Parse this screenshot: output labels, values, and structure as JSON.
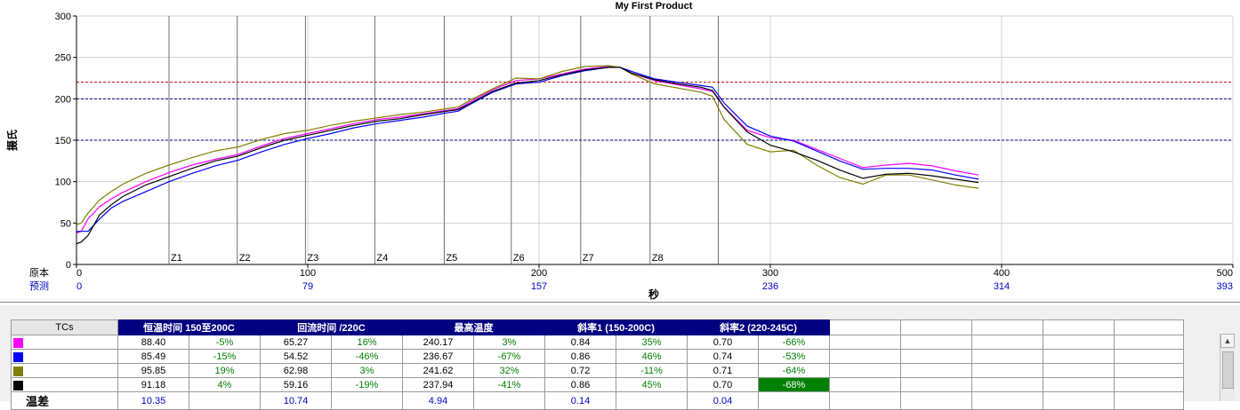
{
  "chart_data": {
    "type": "line",
    "title": "My First Product",
    "ylabel": "摄氏",
    "xlabel": "秒",
    "xlim": [
      0,
      500
    ],
    "ylim": [
      0,
      300
    ],
    "yticks": [
      0,
      50,
      100,
      150,
      200,
      250,
      300
    ],
    "xticks": [
      0,
      100,
      200,
      300,
      400,
      500
    ],
    "xrow_label_1": "原本",
    "xrow_label_2": "预测",
    "xticks_predicted": [
      "0",
      "79",
      "157",
      "236",
      "314",
      "393"
    ],
    "grid": true,
    "zones": [
      {
        "label": "Z1",
        "x": 40
      },
      {
        "label": "Z2",
        "x": 69.5
      },
      {
        "label": "Z3",
        "x": 99
      },
      {
        "label": "Z4",
        "x": 129
      },
      {
        "label": "Z5",
        "x": 159
      },
      {
        "label": "Z6",
        "x": 188
      },
      {
        "label": "Z7",
        "x": 218
      },
      {
        "label": "Z8",
        "x": 248
      },
      {
        "label": "",
        "x": 277.5
      }
    ],
    "reference_lines": [
      {
        "y": 220,
        "color": "#cc0000"
      },
      {
        "y": 200,
        "color": "#00008b"
      },
      {
        "y": 150,
        "color": "#00008b"
      }
    ],
    "series": [
      {
        "color": "#ff00ff",
        "x": [
          0,
          2,
          5,
          10,
          15,
          20,
          30,
          40,
          50,
          60,
          70,
          80,
          90,
          100,
          110,
          120,
          130,
          140,
          150,
          160,
          165,
          170,
          180,
          190,
          200,
          210,
          220,
          230,
          235,
          240,
          250,
          260,
          270,
          275,
          280,
          290,
          300,
          310,
          320,
          330,
          340,
          350,
          360,
          370,
          380,
          390
        ],
        "y": [
          38,
          40,
          55,
          70,
          79,
          87,
          100,
          111,
          120,
          127,
          133,
          143,
          152,
          158,
          164,
          170,
          175,
          178,
          182,
          186,
          188,
          196,
          211,
          222,
          224,
          230,
          236,
          239,
          238,
          231,
          222,
          217,
          212,
          209,
          190,
          162,
          153,
          150,
          139,
          128,
          117,
          120,
          122,
          119,
          113,
          108
        ]
      },
      {
        "color": "#0000ff",
        "x": [
          0,
          2,
          5,
          10,
          15,
          20,
          30,
          40,
          50,
          60,
          70,
          80,
          90,
          100,
          110,
          120,
          130,
          140,
          150,
          160,
          165,
          170,
          180,
          190,
          200,
          210,
          220,
          230,
          235,
          240,
          250,
          260,
          270,
          275,
          280,
          290,
          300,
          310,
          320,
          330,
          340,
          350,
          360,
          370,
          380,
          390
        ],
        "y": [
          40,
          40,
          40,
          55,
          68,
          76,
          88,
          100,
          110,
          119,
          126,
          136,
          145,
          152,
          158,
          165,
          170,
          174,
          178,
          183,
          185,
          193,
          208,
          218,
          220,
          228,
          234,
          238,
          238,
          233,
          224,
          220,
          216,
          214,
          195,
          167,
          155,
          149,
          137,
          125,
          115,
          116,
          116,
          114,
          108,
          103
        ]
      },
      {
        "color": "#808000",
        "x": [
          0,
          2,
          5,
          10,
          15,
          20,
          30,
          40,
          50,
          60,
          70,
          80,
          90,
          100,
          110,
          120,
          130,
          140,
          150,
          160,
          165,
          170,
          180,
          190,
          200,
          210,
          220,
          230,
          235,
          240,
          250,
          260,
          270,
          275,
          280,
          290,
          300,
          310,
          320,
          330,
          340,
          350,
          360,
          370,
          380,
          390
        ],
        "y": [
          48,
          50,
          62,
          78,
          88,
          97,
          110,
          120,
          129,
          137,
          142,
          151,
          158,
          162,
          168,
          173,
          177,
          181,
          184,
          188,
          190,
          198,
          212,
          225,
          224,
          233,
          239,
          240,
          238,
          230,
          218,
          213,
          208,
          203,
          175,
          145,
          136,
          138,
          120,
          105,
          97,
          108,
          108,
          102,
          96,
          92
        ]
      },
      {
        "color": "#000000",
        "x": [
          0,
          2,
          5,
          10,
          15,
          20,
          30,
          40,
          50,
          60,
          70,
          80,
          90,
          100,
          110,
          120,
          130,
          140,
          150,
          160,
          165,
          170,
          180,
          190,
          200,
          210,
          220,
          230,
          235,
          240,
          250,
          260,
          270,
          275,
          280,
          290,
          300,
          310,
          320,
          330,
          340,
          350,
          360,
          370,
          380,
          390
        ],
        "y": [
          25,
          27,
          35,
          60,
          72,
          82,
          96,
          106,
          116,
          125,
          131,
          141,
          150,
          156,
          162,
          168,
          173,
          176,
          181,
          185,
          187,
          194,
          209,
          219,
          222,
          229,
          235,
          238,
          238,
          231,
          223,
          218,
          214,
          210,
          190,
          160,
          144,
          136,
          126,
          114,
          104,
          109,
          110,
          107,
          103,
          99
        ]
      }
    ]
  },
  "table": {
    "tcs_label": "TCs",
    "headers": [
      "恒温时间 150至200C",
      "回流时间 /220C",
      "最高温度",
      "斜率1 (150-200C)",
      "斜率2 (220-245C)"
    ],
    "rows": [
      {
        "color": "#ff00ff",
        "cells": [
          "88.40",
          "-5%",
          "65.27",
          "16%",
          "240.17",
          "3%",
          "0.84",
          "35%",
          "0.70",
          "-66%"
        ]
      },
      {
        "color": "#0000ff",
        "cells": [
          "85.49",
          "-15%",
          "54.52",
          "-46%",
          "236.67",
          "-67%",
          "0.86",
          "46%",
          "0.74",
          "-53%"
        ]
      },
      {
        "color": "#808000",
        "cells": [
          "95.85",
          "19%",
          "62.98",
          "3%",
          "241.62",
          "32%",
          "0.72",
          "-11%",
          "0.71",
          "-64%"
        ]
      },
      {
        "color": "#000000",
        "cells": [
          "91.18",
          "4%",
          "59.16",
          "-19%",
          "237.94",
          "-41%",
          "0.86",
          "45%",
          "0.70",
          "-68%"
        ]
      }
    ],
    "diff_row": {
      "label": "温差",
      "values": [
        "10.35",
        "10.74",
        "4.94",
        "0.14",
        "0.04"
      ]
    },
    "highlight": "-68%"
  }
}
